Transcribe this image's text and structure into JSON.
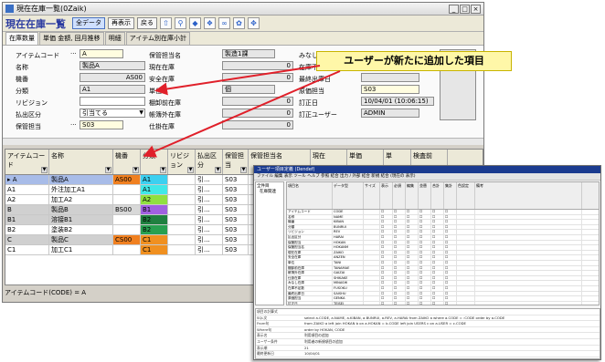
{
  "window": {
    "title": "現在在庫一覧(0Zaik)",
    "controls": [
      "_",
      "□",
      "×"
    ]
  },
  "toolbar": {
    "title": "現在在庫一覧",
    "buttons": [
      {
        "label": "全データ",
        "active": true
      },
      {
        "label": "再表示",
        "active": false
      },
      {
        "label": "戻る",
        "active": false
      }
    ],
    "icons": [
      "up-arrow-icon",
      "filter-icon",
      "tag-icon",
      "tree-icon",
      "binoculars-icon",
      "gear-icon",
      "move-icon"
    ]
  },
  "tabs": [
    "在庫数量",
    "単価 金額, 回月推移",
    "明細",
    "アイテム別在庫小計"
  ],
  "form": {
    "item_code_label": "アイテムコード",
    "item_code_prefix": "···",
    "item_code_value": "A",
    "name_label": "名称",
    "name_value": "製品A",
    "kishu_label": "機番",
    "kishu_value": "AS00",
    "bunrui_label": "分類",
    "bunrui_value": "A1",
    "revision_label": "リビジョン",
    "revision_value": "",
    "haraidashi_label": "払出区分",
    "haraidashi_value": "引当てる",
    "hokan_label": "保管担当",
    "hokan_value": "S03",
    "hokan_prefix": "···",
    "hokan_tanto_label": "保管担当名",
    "hokan_tanto_value": "製造1課",
    "genzai_label": "現在在庫",
    "genzai_value": "0",
    "anzen_label": "安全在庫",
    "anzen_value": "0",
    "tani_label": "単位",
    "tani_value": "個",
    "tanaoroshi_label": "棚卸前在庫",
    "tanaoroshi_value": "0",
    "kakutei_label": "帳簿外在庫",
    "kakutei_value": "0",
    "shiyo_label": "仕掛在庫",
    "shiyo_value": "0",
    "mimoto_label": "みなし在",
    "fusoku_label": "在庫不足数",
    "saishu_label": "最終出庫日",
    "genka_label": "原価担当",
    "genka_value": "S03",
    "kotei_label": "訂正日",
    "kotei_value": "10/04/01 (10:06:15)",
    "kotei_user_label": "訂正ユーザー",
    "kotei_user_value": "ADMIN"
  },
  "grid": {
    "headers": [
      "アイテムコード",
      "名称",
      "機番",
      "分類",
      "リビジョン",
      "払出区分",
      "保管担当",
      "保管担当名",
      "現在",
      "単価",
      "単",
      "検査前"
    ],
    "rows": [
      {
        "code": "A",
        "name": "製品A",
        "kishu": "AS00",
        "bunrui": "A1",
        "hara": "引...",
        "hokan": "S03",
        "color": "#b8b8b8",
        "kcolor": "#f08020",
        "bcolor": "#3cd0f0",
        "selected": true
      },
      {
        "code": "A1",
        "name": "外注加工A1",
        "kishu": "",
        "bunrui": "A1",
        "hara": "引...",
        "hokan": "S03",
        "color": "#ffffff",
        "kcolor": "#ffffff",
        "bcolor": "#40e8e8",
        "selected": false
      },
      {
        "code": "A2",
        "name": "加工A2",
        "kishu": "",
        "bunrui": "A2",
        "hara": "引...",
        "hokan": "S03",
        "color": "#ffffff",
        "kcolor": "#ffffff",
        "bcolor": "#90e040",
        "selected": false
      },
      {
        "code": "B",
        "name": "製品B",
        "kishu": "BS00",
        "bunrui": "B1",
        "hara": "引...",
        "hokan": "S03",
        "color": "#d0d0d0",
        "kcolor": "#d8d8d8",
        "bcolor": "#a060e0",
        "selected": false
      },
      {
        "code": "B1",
        "name": "溶接B1",
        "kishu": "",
        "bunrui": "B2",
        "hara": "引...",
        "hokan": "S03",
        "color": "#d0d0d0",
        "kcolor": "#ffffff",
        "bcolor": "#208040",
        "selected": false
      },
      {
        "code": "B2",
        "name": "塗装B2",
        "kishu": "",
        "bunrui": "B2",
        "hara": "引...",
        "hokan": "S03",
        "color": "#ffffff",
        "kcolor": "#ffffff",
        "bcolor": "#28a050",
        "selected": false
      },
      {
        "code": "C",
        "name": "製品C",
        "kishu": "CS00",
        "bunrui": "C1",
        "hara": "引...",
        "hokan": "S03",
        "color": "#d0d0d0",
        "kcolor": "#f08020",
        "bcolor": "#f09020",
        "selected": false
      },
      {
        "code": "C1",
        "name": "加工C1",
        "kishu": "",
        "bunrui": "C1",
        "hara": "引...",
        "hokan": "S03",
        "color": "#ffffff",
        "kcolor": "#ffffff",
        "bcolor": "#f09020",
        "selected": false
      }
    ]
  },
  "status": "アイテムコード(CODE) = A",
  "callout": "ユーザーが新たに追加した項目",
  "inset": {
    "title": "ユーザー項目定義 (Dendef)",
    "toolbar": "ファイル  編集  表示  ツール  ヘルプ  参照 結合  出力 / 外部 結合  新規 結合  (現在の 表示)",
    "tree": [
      "全件目",
      "在庫関連"
    ],
    "header": [
      "項目名",
      "データ型",
      "サイズ",
      "表示",
      "必須",
      "編集",
      "並替",
      "合計",
      "集計",
      "色設定",
      "備考"
    ],
    "rows": [
      [
        "アイテムコード",
        "CODE",
        "",
        "",
        "",
        "",
        ""
      ],
      [
        "名称",
        "NAME",
        "",
        "",
        "",
        "",
        ""
      ],
      [
        "機番",
        "KIBAN",
        "",
        "",
        "",
        "",
        ""
      ],
      [
        "分類",
        "BUNRUI",
        "",
        "",
        "",
        "",
        ""
      ],
      [
        "リビジョン",
        "REV",
        "",
        "",
        "",
        "",
        ""
      ],
      [
        "払出区分",
        "HARAI",
        "",
        "",
        "",
        "",
        ""
      ],
      [
        "保管担当",
        "HOKAN",
        "",
        "",
        "",
        "",
        ""
      ],
      [
        "保管担当名",
        "HOKANM",
        "",
        "",
        "",
        "",
        ""
      ],
      [
        "現在在庫",
        "ZAIKO",
        "",
        "",
        "",
        "",
        ""
      ],
      [
        "安全在庫",
        "ANZEN",
        "",
        "",
        "",
        "",
        ""
      ],
      [
        "単位",
        "TANI",
        "",
        "",
        "",
        "",
        ""
      ],
      [
        "棚卸前在庫",
        "TANAMAE",
        "",
        "",
        "",
        "",
        ""
      ],
      [
        "帳簿外在庫",
        "GAIZAI",
        "",
        "",
        "",
        "",
        ""
      ],
      [
        "仕掛在庫",
        "SHIKAKE",
        "",
        "",
        "",
        "",
        ""
      ],
      [
        "みなし在庫",
        "MINASHI",
        "",
        "",
        "",
        "",
        ""
      ],
      [
        "在庫不足数",
        "FUSOKU",
        "",
        "",
        "",
        "",
        ""
      ],
      [
        "最終出庫日",
        "SAISHU",
        "",
        "",
        "",
        "",
        ""
      ],
      [
        "原価担当",
        "GENKA",
        "",
        "",
        "",
        "",
        ""
      ],
      [
        "訂正日",
        "TEISEI",
        "",
        "",
        "",
        "",
        ""
      ],
      [
        "訂正ユーザー",
        "USER",
        "",
        "",
        "",
        "",
        ""
      ]
    ],
    "selected_row": 19,
    "bottom": [
      {
        "label": "項目の計算式",
        "value": ""
      },
      {
        "label": "SQL文",
        "value": "select a.CODE, a.NAME, a.KIBAN, a.BUNRUI, a.REV, a.HARAI from ZAIKO a where a.CODE = :CODE order by a.CODE"
      },
      {
        "label": "From句",
        "value": "from ZAIKO a left join HOKAN b on a.HOKAN = b.CODE left join USERS c on a.USER = c.CODE"
      },
      {
        "label": "Where句",
        "value": "order by HOKAN, CODE"
      },
      {
        "label": "表示名",
        "value": "利用項目の追加"
      },
      {
        "label": "ユーザー条件",
        "value": "利用者の新規項目の追加"
      },
      {
        "label": "表示順",
        "value": "21"
      },
      {
        "label": "最終更新日",
        "value": "10/04/01"
      }
    ]
  }
}
